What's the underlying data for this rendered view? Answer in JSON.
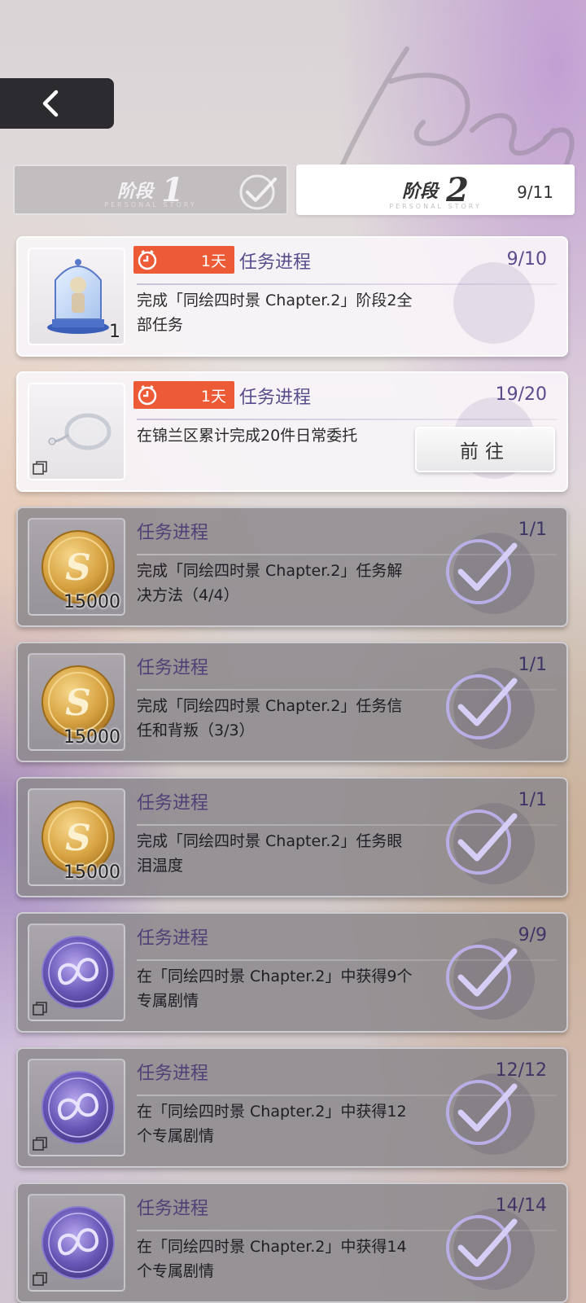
{
  "nav": {
    "back_icon": "chevron-left-icon"
  },
  "stage_tabs": [
    {
      "label": "阶段",
      "number": "1",
      "subtitle": "PERSONAL STORY",
      "completed": true,
      "active": false
    },
    {
      "label": "阶段",
      "number": "2",
      "subtitle": "PERSONAL STORY",
      "progress": "9/11",
      "active": true
    }
  ],
  "tasks": [
    {
      "title": "任务进程",
      "progress": "9/10",
      "timer": "1天",
      "status": "pending",
      "description": "完成「同绘四时景 Chapter.2」阶段2全部任务",
      "reward": {
        "icon": "figurine-dome-icon",
        "quantity": "1"
      }
    },
    {
      "title": "任务进程",
      "progress": "19/20",
      "timer": "1天",
      "status": "pending",
      "description": "在锦兰区累计完成20件日常委托",
      "action_label": "前往",
      "reward": {
        "icon": "earring-icon",
        "quantity": ""
      }
    },
    {
      "title": "任务进程",
      "progress": "1/1",
      "status": "done",
      "description": "完成「同绘四时景 Chapter.2」任务解决方法（4/4）",
      "reward": {
        "icon": "gold-coin-icon",
        "quantity": "15000"
      }
    },
    {
      "title": "任务进程",
      "progress": "1/1",
      "status": "done",
      "description": "完成「同绘四时景 Chapter.2」任务信任和背叛（3/3）",
      "reward": {
        "icon": "gold-coin-icon",
        "quantity": "15000"
      }
    },
    {
      "title": "任务进程",
      "progress": "1/1",
      "status": "done",
      "description": "完成「同绘四时景 Chapter.2」任务眼泪温度",
      "reward": {
        "icon": "gold-coin-icon",
        "quantity": "15000"
      }
    },
    {
      "title": "任务进程",
      "progress": "9/9",
      "status": "done",
      "description": "在「同绘四时景 Chapter.2」中获得9个专属剧情",
      "reward": {
        "icon": "purple-emblem-icon",
        "quantity": ""
      }
    },
    {
      "title": "任务进程",
      "progress": "12/12",
      "status": "done",
      "description": "在「同绘四时景 Chapter.2」中获得12个专属剧情",
      "reward": {
        "icon": "purple-emblem-icon",
        "quantity": ""
      }
    },
    {
      "title": "任务进程",
      "progress": "14/14",
      "status": "done",
      "description": "在「同绘四时景 Chapter.2」中获得14个专属剧情",
      "reward": {
        "icon": "purple-emblem-icon",
        "quantity": ""
      }
    }
  ],
  "colors": {
    "accent": "#5a4c8c",
    "timer_badge": "#ec5a36",
    "back_button": "#2c2c30",
    "done_card": "#8c888c",
    "check": "#b9aee6"
  }
}
